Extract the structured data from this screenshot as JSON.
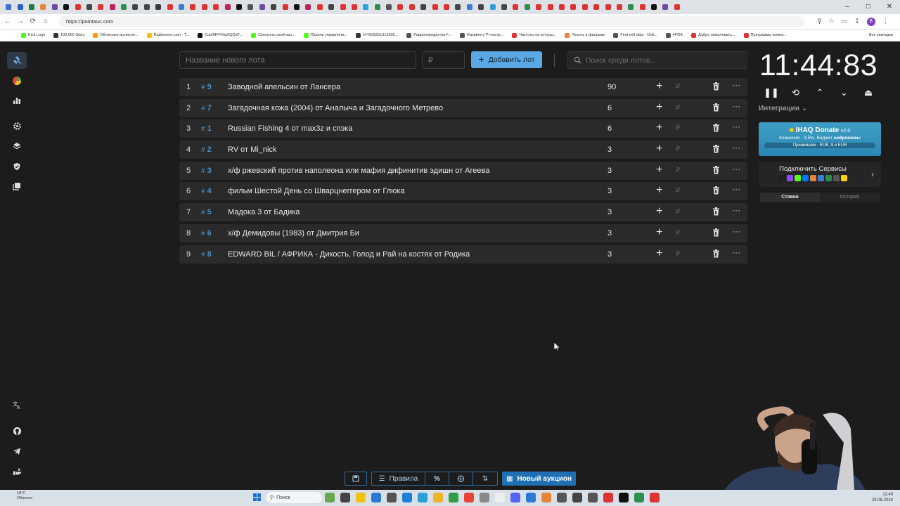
{
  "browser": {
    "tab_colors": [
      "#3b6fd8",
      "#2b5fc7",
      "#1e7a3f",
      "#e8833a",
      "#6b4aa8",
      "#111111",
      "#d33",
      "#444",
      "#d33",
      "#c0215a",
      "#2f8f4e",
      "#444",
      "#444",
      "#3a3a3a",
      "#d33",
      "#3a7bd5",
      "#d33",
      "#d33",
      "#d33",
      "#c0215a",
      "#111",
      "#555",
      "#6b4aa8",
      "#444",
      "#d33",
      "#111",
      "#c0215a",
      "#d33",
      "#444",
      "#d33",
      "#d33",
      "#2ea0d8",
      "#2f8f4e",
      "#555",
      "#d33",
      "#d33",
      "#444",
      "#d33",
      "#d33",
      "#444",
      "#3a7bd5",
      "#444",
      "#2ea0d8",
      "#444",
      "#d33",
      "#2f8f4e",
      "#d33",
      "#d33",
      "#d33",
      "#d33",
      "#d33",
      "#d33",
      "#d33",
      "#d33",
      "#2f8f4e",
      "#d33",
      "#111",
      "#6b4aa8",
      "#d33"
    ],
    "url": "https://pointauc.com",
    "profile_initial": "B",
    "bookmarks": [
      {
        "label": "Kick Logo",
        "color": "#53fc18"
      },
      {
        "label": "100,000 Stars",
        "color": "#333"
      },
      {
        "label": "Облачные вычисле...",
        "color": "#ff9900"
      },
      {
        "label": "Radiooooo.com - T...",
        "color": "#f4c20d"
      },
      {
        "label": "Cop/MFFXfgXQQdT...",
        "color": "#111"
      },
      {
        "label": "Смотреть свой кан...",
        "color": "#53fc18"
      },
      {
        "label": "Панель управлени...",
        "color": "#53fc18"
      },
      {
        "label": "147628261312595...",
        "color": "#333"
      },
      {
        "label": "Радиопередатчик F...",
        "color": "#555"
      },
      {
        "label": "Raspberry Pi настр...",
        "color": "#555"
      },
      {
        "label": "Частоты на которы...",
        "color": "#d33"
      },
      {
        "label": "Тексты в фильмах",
        "color": "#e8833a"
      },
      {
        "label": "Find exif data - Onli...",
        "color": "#555"
      },
      {
        "label": "4PDA",
        "color": "#555"
      },
      {
        "label": "Добро пожаловать...",
        "color": "#d33"
      },
      {
        "label": "Программы компа...",
        "color": "#d33"
      }
    ],
    "all_bookmarks": "Все закладки"
  },
  "toolbar": {
    "new_lot_placeholder": "Название нового лота",
    "price_placeholder": "₽",
    "add_lot_label": "Добавить лот",
    "search_placeholder": "Поиск среди лотов..."
  },
  "lots": [
    {
      "index": "1",
      "fast_id": "9",
      "name": "Заводной апельсин от Лансера",
      "amount": "90"
    },
    {
      "index": "2",
      "fast_id": "7",
      "name": "Загадочная кожа (2004) от Аналыча и Загадочного Метрево",
      "amount": "6"
    },
    {
      "index": "3",
      "fast_id": "1",
      "name": "Russian Fishing 4 от max3z и спэка",
      "amount": "6"
    },
    {
      "index": "4",
      "fast_id": "2",
      "name": "RV от Mi_nick",
      "amount": "3"
    },
    {
      "index": "5",
      "fast_id": "3",
      "name": "х/ф ржевский против наполеона или мафия дифинитив эдишн от Агеева",
      "amount": "3"
    },
    {
      "index": "6",
      "fast_id": "4",
      "name": " фильм Шестой День со Шварцнеггером от Глюка",
      "amount": "3"
    },
    {
      "index": "7",
      "fast_id": "5",
      "name": "Мадока 3 от Бадика",
      "amount": "3"
    },
    {
      "index": "8",
      "fast_id": "6",
      "name": "х/ф Демидовы (1983) от Дмитрия Би",
      "amount": "3"
    },
    {
      "index": "9",
      "fast_id": "8",
      "name": "EDWARD BIL / АФРИКА - Дикость, Голод и Рай на костях от Родика",
      "amount": "3"
    }
  ],
  "row_symbols": {
    "hash": "#",
    "plus": "+",
    "rub": "₽",
    "more": "···"
  },
  "timer": {
    "value": "11:44:83"
  },
  "integrations": {
    "label": "Интеграции"
  },
  "donate": {
    "title": "IHAQ Donate",
    "version": "v2.0",
    "commission": "Комиссия - 3,5%, Виджет ",
    "commission_bold": "нейромемы",
    "accepts": "Принимаем - RUB, $ и EUR"
  },
  "services": {
    "label": "Подключить Сервисы",
    "logo_colors": [
      "#1f1f1f",
      "#9146ff",
      "#53fc18",
      "#0077ff",
      "#e8833a",
      "#3a7bd5",
      "#2f8f4e",
      "#555",
      "#ffd400"
    ]
  },
  "history_tabs": {
    "bets": "Ставки",
    "history": "История"
  },
  "bottom": {
    "rules": "Правила",
    "new_auction": "Новый аукцион",
    "percent": "%"
  },
  "taskbar": {
    "temp": "18°C",
    "weather": "Облачно",
    "search": "Поиск",
    "time": "11:49",
    "date": "29.08.2024",
    "app_colors": [
      "#6aa84f",
      "#444",
      "#f4c20d",
      "#2a7ad3",
      "#555",
      "#1e7fd6",
      "#2ea0d8",
      "#f0b429",
      "#2f9e44",
      "#ea4335",
      "#888",
      "#eee",
      "#5865f2",
      "#2a7ad3",
      "#e8833a",
      "#555",
      "#444",
      "#555",
      "#d33",
      "#111",
      "#2f8f4e",
      "#d33"
    ]
  }
}
